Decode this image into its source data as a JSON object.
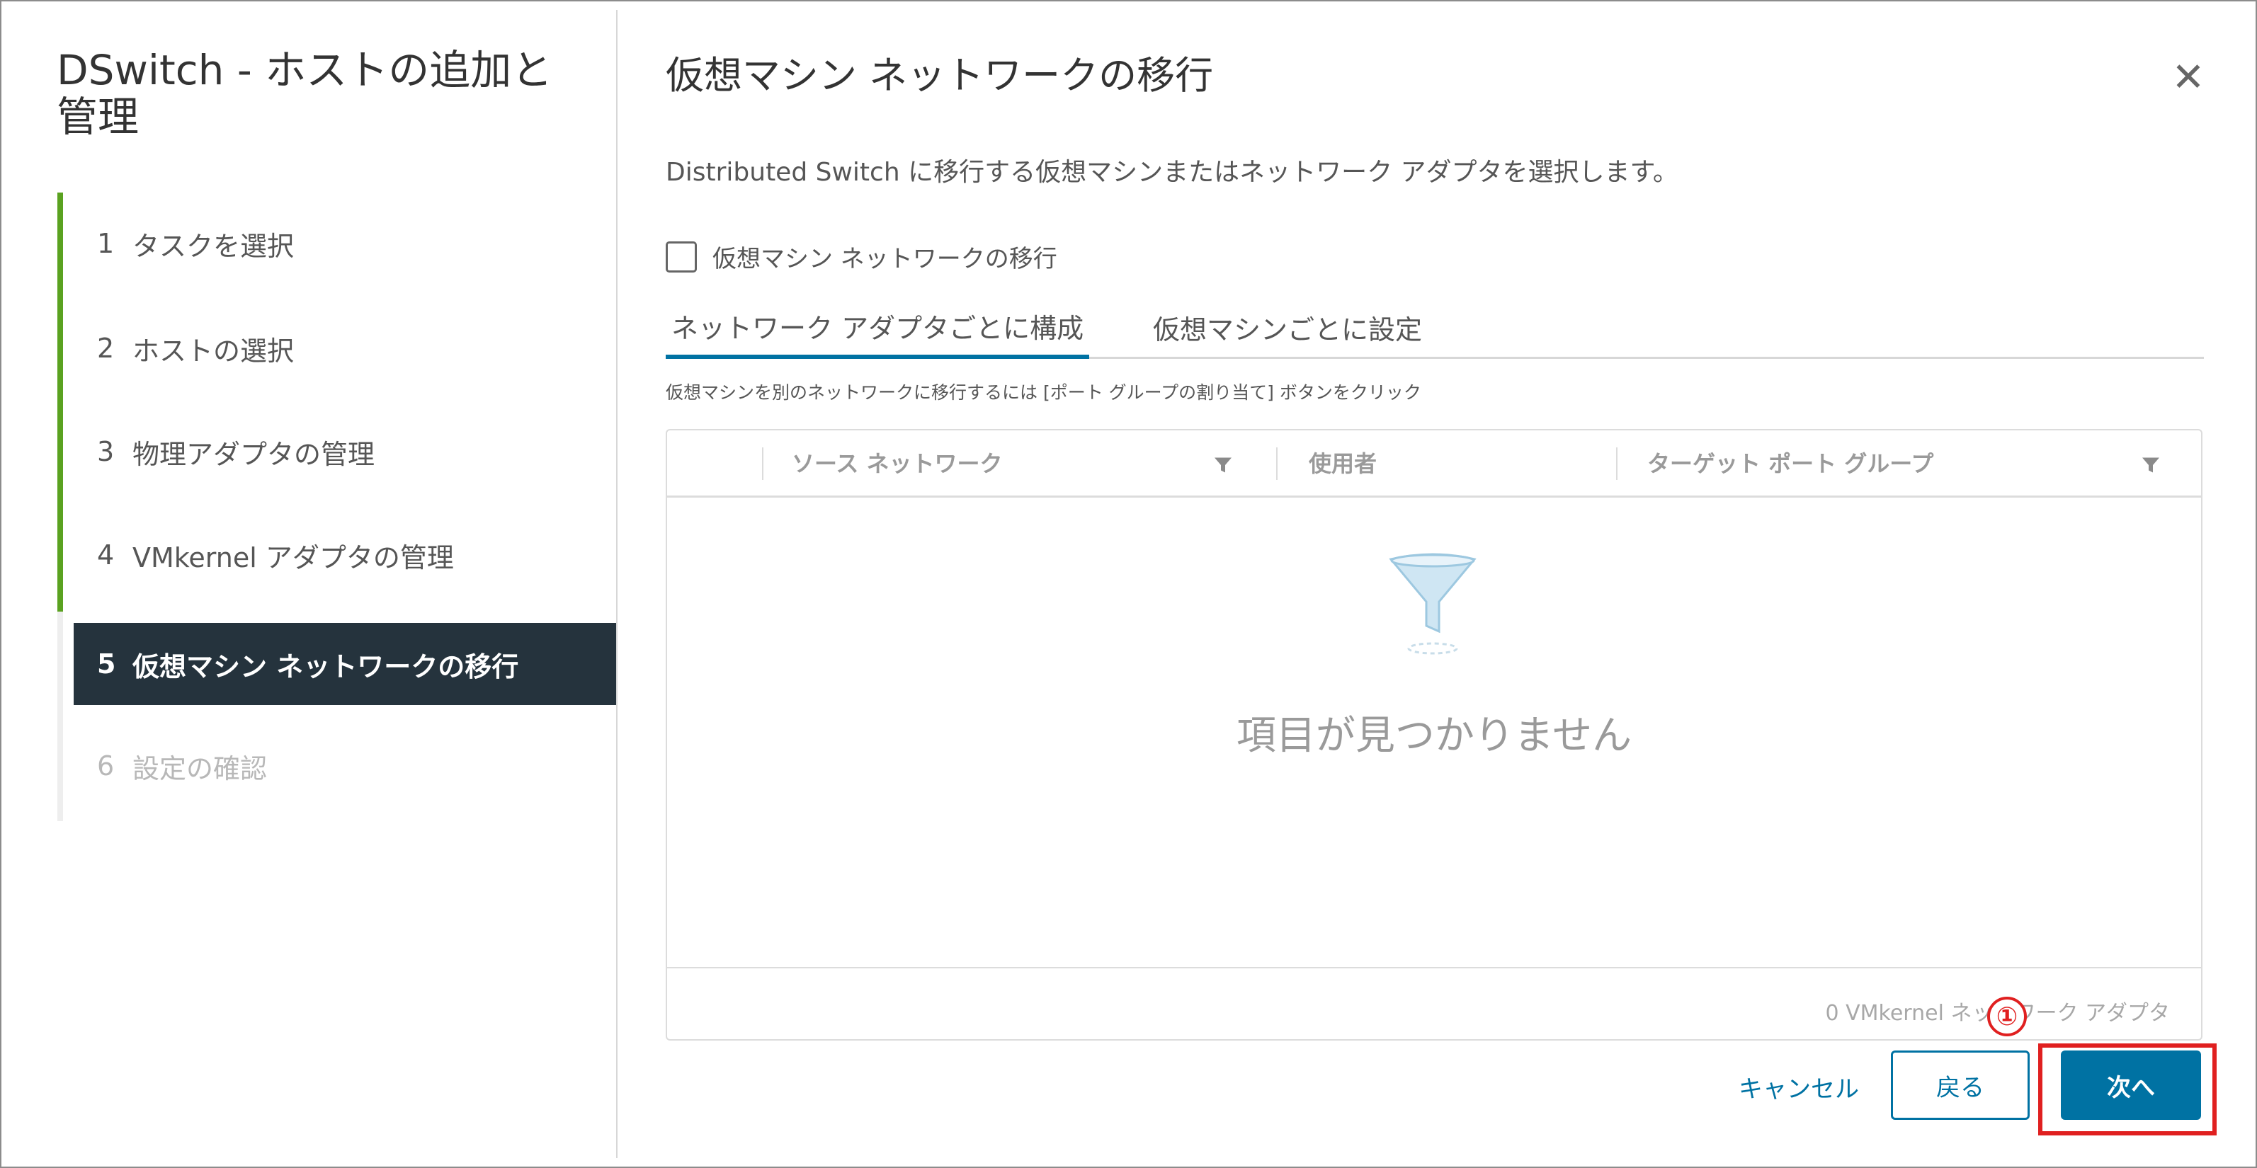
{
  "sidebar": {
    "title": "DSwitch - ホストの追加と管理",
    "steps": [
      {
        "num": "1",
        "label": "タスクを選択"
      },
      {
        "num": "2",
        "label": "ホストの選択"
      },
      {
        "num": "3",
        "label": "物理アダプタの管理"
      },
      {
        "num": "4",
        "label": "VMkernel アダプタの管理"
      },
      {
        "num": "5",
        "label": "仮想マシン ネットワークの移行"
      },
      {
        "num": "6",
        "label": "設定の確認"
      }
    ],
    "active_step": 5
  },
  "main": {
    "title": "仮想マシン ネットワークの移行",
    "close_icon": "close-icon",
    "description": "Distributed Switch に移行する仮想マシンまたはネットワーク アダプタを選択します。",
    "checkbox_label": "仮想マシン ネットワークの移行",
    "checkbox_checked": false,
    "tabs": [
      {
        "label": "ネットワーク アダプタごとに構成",
        "active": true
      },
      {
        "label": "仮想マシンごとに設定",
        "active": false
      }
    ],
    "hint": "仮想マシンを別のネットワークに移行するには [ポート グループの割り当て] ボタンをクリック",
    "grid": {
      "columns": [
        "ソース ネットワーク",
        "使用者",
        "ターゲット ポート グループ"
      ],
      "empty_text": "項目が見つかりません",
      "footer": "0 VMkernel ネットワーク アダプタ"
    }
  },
  "buttons": {
    "cancel": "キャンセル",
    "back": "戻る",
    "next": "次へ"
  },
  "annotation": {
    "callout": "①"
  },
  "colors": {
    "accent": "#0072a3",
    "progress": "#5aa220",
    "active_step_bg": "#25333d",
    "highlight": "#e02020"
  }
}
